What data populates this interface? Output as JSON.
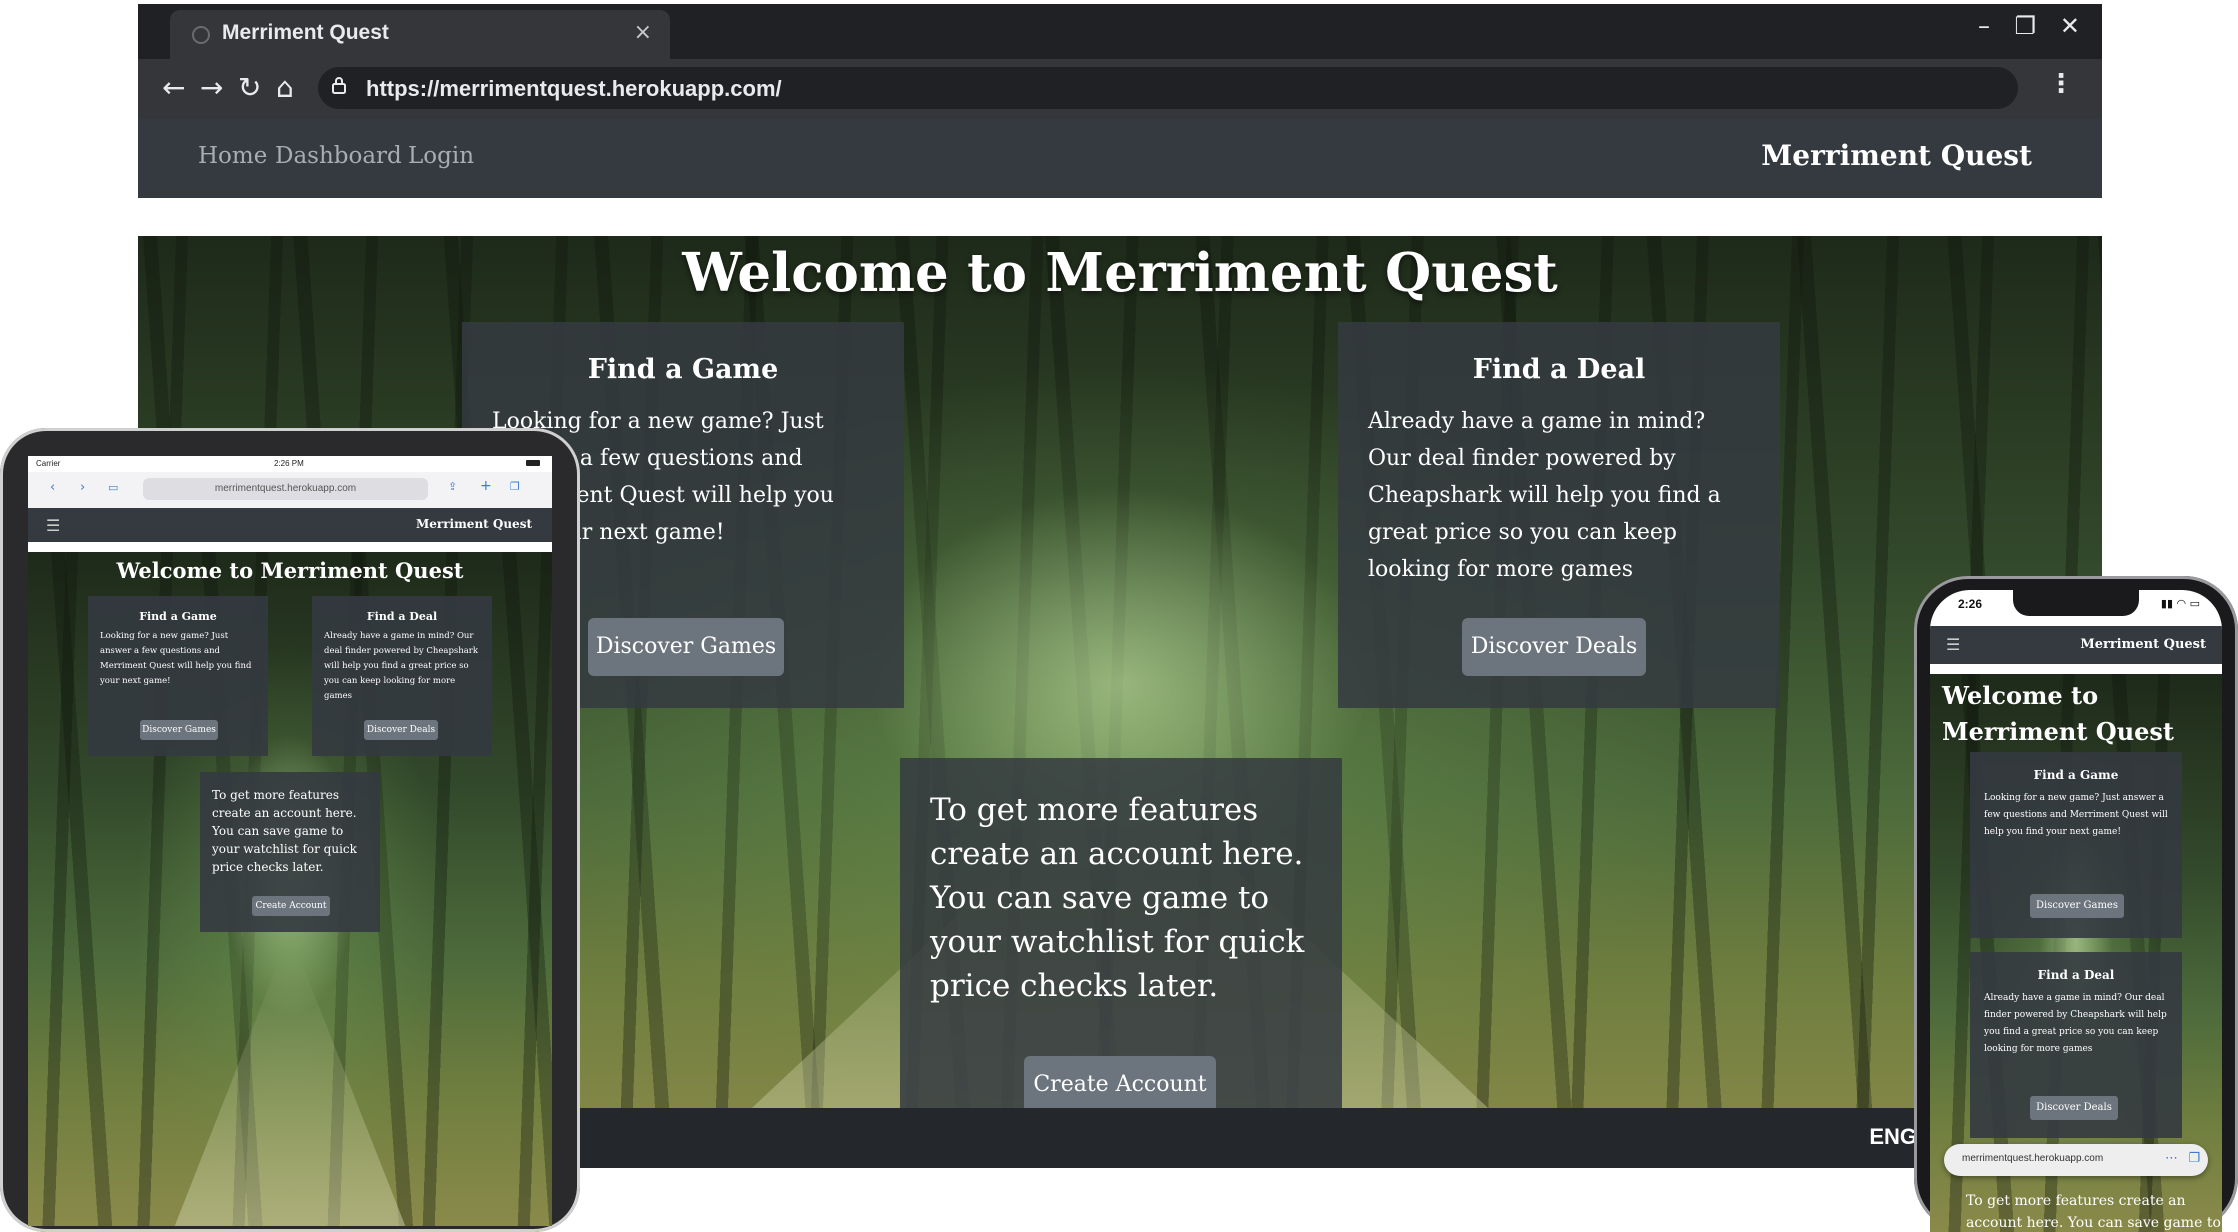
{
  "browser": {
    "tab_title": "Merriment Quest",
    "tab_close": "×",
    "url": "https://merrimentquest.herokuapp.com/",
    "window_controls": [
      "–",
      "❐",
      "✕"
    ],
    "icons": [
      "back-icon",
      "forward-icon",
      "reload-icon",
      "home-icon",
      "lock-icon",
      "more-icon"
    ]
  },
  "navbar": {
    "links": [
      "Home",
      "Dashboard",
      "Login"
    ],
    "brand": "Merriment Quest"
  },
  "hero": {
    "title": "Welcome to Merriment Quest",
    "find_game": {
      "heading": "Find a Game",
      "body": "Looking for a new game? Just answer a few questions and Merriment Quest will help you find your next game!",
      "button": "Discover Games"
    },
    "find_deal": {
      "heading": "Find a Deal",
      "body": "Already have a game in mind? Our deal finder powered by Cheapshark will help you find a great price so you can keep looking for more games",
      "button": "Discover Deals"
    },
    "account": {
      "body": "To get more features create an account here. You can save game to your watchlist for quick price checks later.",
      "button": "Create Account"
    }
  },
  "taskbar": {
    "language": "ENG"
  },
  "tablet": {
    "carrier": "Carrier",
    "time": "2:26 PM",
    "url": "merrimentquest.herokuapp.com"
  },
  "phone": {
    "time": "2:26",
    "url": "merrimentquest.herokuapp.com"
  },
  "colors": {
    "navbar": "#343a40",
    "card": "#343a40",
    "button": "#6c757d",
    "browser_chrome": "#202124"
  }
}
